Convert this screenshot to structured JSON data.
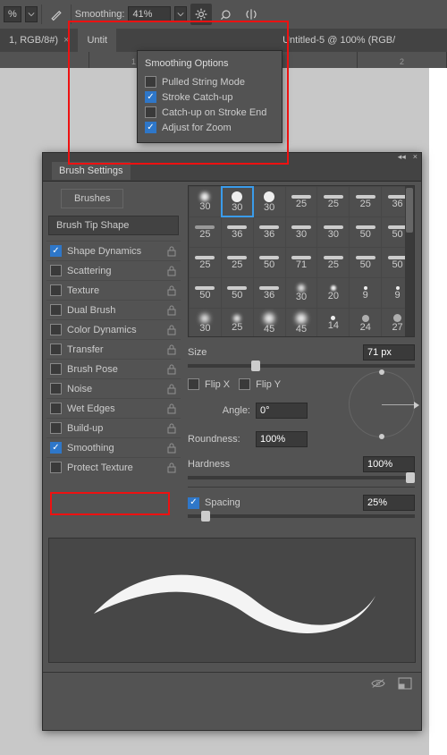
{
  "toolbar": {
    "pct_field": "%",
    "smoothing_label": "Smoothing:",
    "smoothing_value": "41%"
  },
  "tabs": {
    "t0": "1, RGB/8#)",
    "t1": "Untit",
    "t2": "Untitled-5 @ 100% (RGB/"
  },
  "ruler": {
    "r0": "",
    "r1": "1",
    "r2": "",
    "r3": "",
    "r4": "2"
  },
  "popup": {
    "title": "Smoothing Options",
    "opt0": "Pulled String Mode",
    "opt1": "Stroke Catch-up",
    "opt2": "Catch-up on Stroke End",
    "opt3": "Adjust for Zoom"
  },
  "panel": {
    "title": "Brush Settings",
    "brushes_btn": "Brushes",
    "tip_btn": "Brush Tip Shape",
    "opts": {
      "o0": "Shape Dynamics",
      "o1": "Scattering",
      "o2": "Texture",
      "o3": "Dual Brush",
      "o4": "Color Dynamics",
      "o5": "Transfer",
      "o6": "Brush Pose",
      "o7": "Noise",
      "o8": "Wet Edges",
      "o9": "Build-up",
      "o10": "Smoothing",
      "o11": "Protect Texture"
    },
    "grid": {
      "r0": [
        "30",
        "30",
        "30",
        "25",
        "25",
        "25",
        "36"
      ],
      "r1": [
        "25",
        "36",
        "36",
        "30",
        "30",
        "50",
        "50"
      ],
      "r2": [
        "25",
        "25",
        "50",
        "71",
        "25",
        "50",
        "50"
      ],
      "r3": [
        "50",
        "50",
        "36",
        "30",
        "20",
        "9",
        "9"
      ],
      "r4": [
        "30",
        "25",
        "45",
        "45",
        "14",
        "24",
        "27"
      ]
    },
    "size_lbl": "Size",
    "size_val": "71 px",
    "flipx": "Flip X",
    "flipy": "Flip Y",
    "angle_lbl": "Angle:",
    "angle_val": "0°",
    "round_lbl": "Roundness:",
    "round_val": "100%",
    "hard_lbl": "Hardness",
    "hard_val": "100%",
    "spacing_lbl": "Spacing",
    "spacing_val": "25%"
  }
}
